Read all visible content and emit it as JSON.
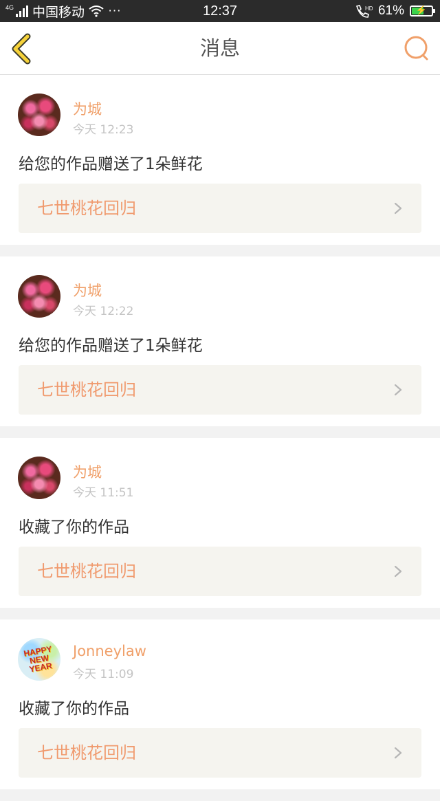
{
  "status_bar": {
    "network_tag": "4G",
    "carrier": "中国移动",
    "dots": "···",
    "time": "12:37",
    "battery_percent": "61%",
    "battery_level": 0.61,
    "battery_color": "#3cd24a",
    "icons": [
      "signal-icon",
      "wifi-icon",
      "hd-call-icon",
      "battery-icon"
    ]
  },
  "nav": {
    "title": "消息",
    "back_icon": "chevron-left-icon",
    "search_icon": "search-icon",
    "accent": "#f0a06a"
  },
  "messages": [
    {
      "user": "为城",
      "time": "今天 12:23",
      "text": "给您的作品赠送了1朵鲜花",
      "work": "七世桃花回归",
      "avatar": "flower"
    },
    {
      "user": "为城",
      "time": "今天 12:22",
      "text": "给您的作品赠送了1朵鲜花",
      "work": "七世桃花回归",
      "avatar": "flower"
    },
    {
      "user": "为城",
      "time": "今天 11:51",
      "text": "收藏了你的作品",
      "work": "七世桃花回归",
      "avatar": "flower"
    },
    {
      "user": "Jonneylaw",
      "time": "今天 11:09",
      "text": "收藏了你的作品",
      "work": "七世桃花回归",
      "avatar": "newyear",
      "avatar_text": "HAPPY NEW YEAR"
    }
  ]
}
